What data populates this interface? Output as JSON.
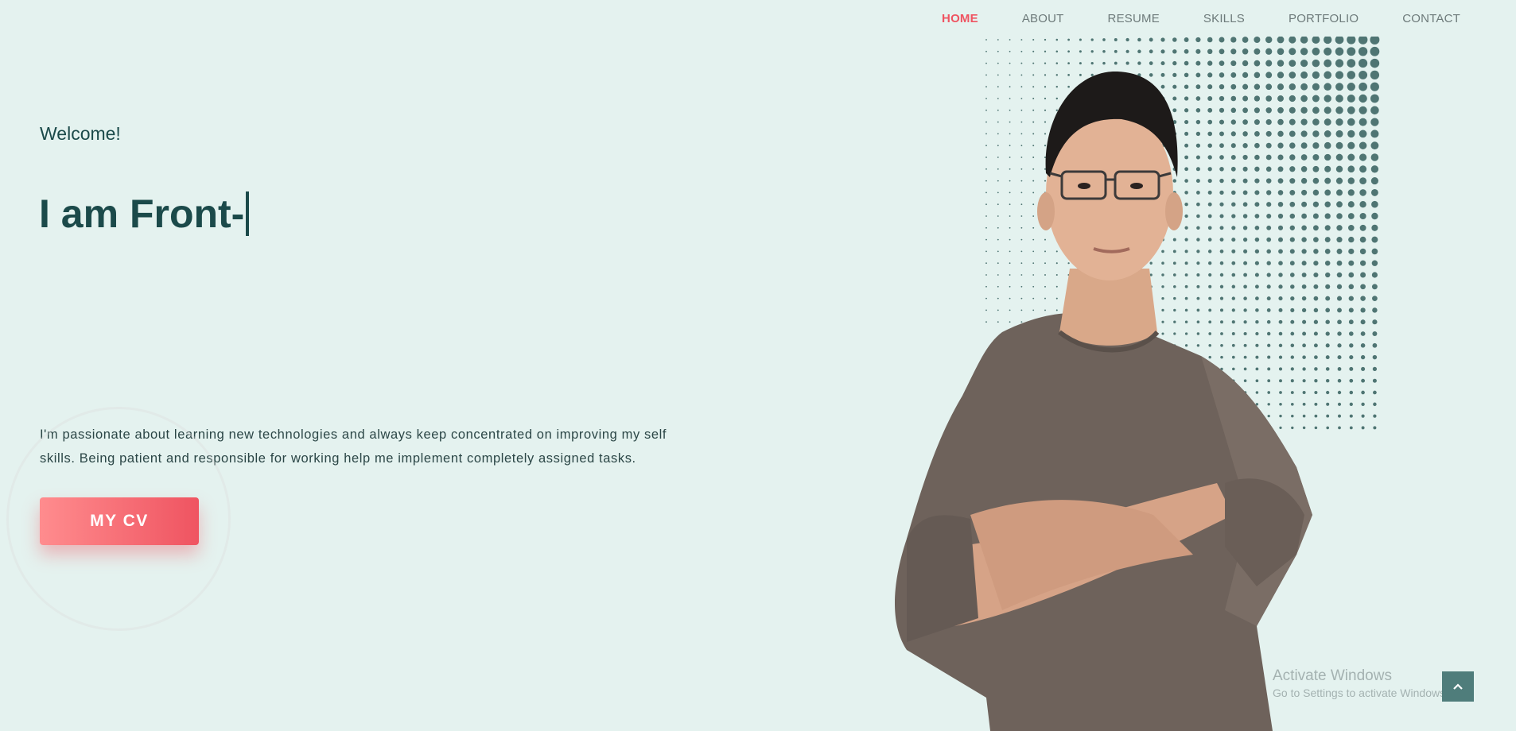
{
  "nav": {
    "items": [
      "HOME",
      "ABOUT",
      "RESUME",
      "SKILLS",
      "PORTFOLIO",
      "CONTACT"
    ],
    "active_index": 0
  },
  "hero": {
    "welcome": "Welcome!",
    "headline": "I am Front-",
    "bio_line1": "I'm passionate about learning new technologies and always keep concentrated on improving my self",
    "bio_line2": "skills. Being patient and responsible for working help me implement completely assigned tasks.",
    "cv_label": "MY CV"
  },
  "watermark": {
    "title": "Activate Windows",
    "subtitle": "Go to Settings to activate Windows."
  },
  "icons": {
    "back_to_top": "chevron-up-icon"
  },
  "colors": {
    "background": "#e4f2ef",
    "accent": "#ef5461",
    "text_dark": "#1b4a4a",
    "dot": "#4f7573",
    "scroll_button": "#4f7d7b"
  }
}
